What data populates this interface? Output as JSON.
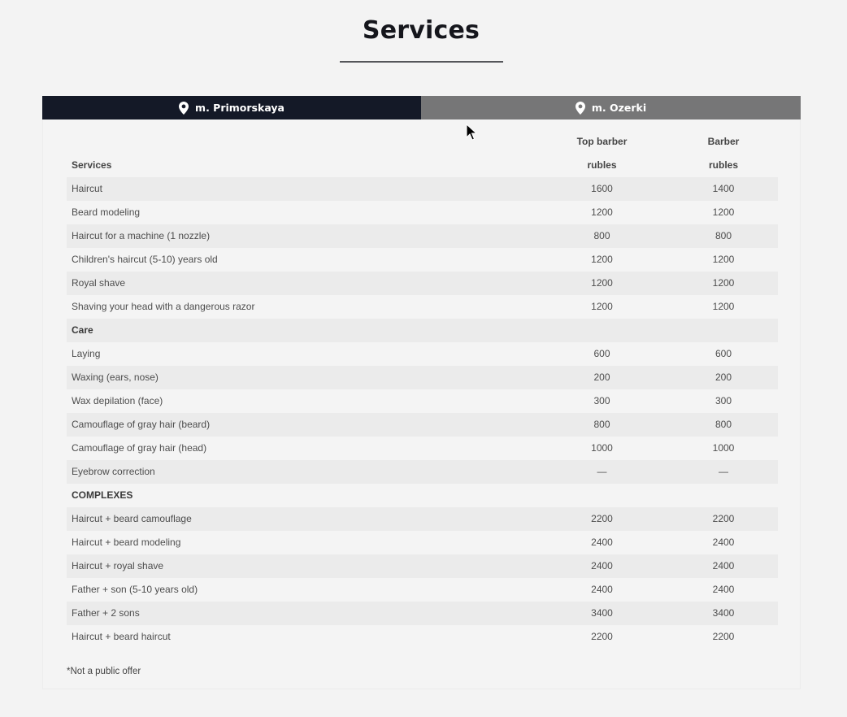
{
  "page_title": "Services",
  "tabs": [
    {
      "label": "m. Primorskaya",
      "active": true,
      "icon": "map-pin-icon"
    },
    {
      "label": "m. Ozerki",
      "active": false,
      "icon": "map-pin-icon"
    }
  ],
  "table": {
    "header_top": [
      "",
      "Top barber",
      "Barber"
    ],
    "header_bottom": [
      "Services",
      "rubles",
      "rubles"
    ],
    "rows": [
      {
        "name": "Haircut",
        "top": "1600",
        "barber": "1400",
        "type": "item"
      },
      {
        "name": "Beard modeling",
        "top": "1200",
        "barber": "1200",
        "type": "item"
      },
      {
        "name": "Haircut for a machine (1 nozzle)",
        "top": "800",
        "barber": "800",
        "type": "item"
      },
      {
        "name": "Children's haircut (5-10) years old",
        "top": "1200",
        "barber": "1200",
        "type": "item"
      },
      {
        "name": "Royal shave",
        "top": "1200",
        "barber": "1200",
        "type": "item"
      },
      {
        "name": "Shaving your head with a dangerous razor",
        "top": "1200",
        "barber": "1200",
        "type": "item"
      },
      {
        "name": "Care",
        "top": "",
        "barber": "",
        "type": "section"
      },
      {
        "name": "Laying",
        "top": "600",
        "barber": "600",
        "type": "item"
      },
      {
        "name": "Waxing (ears, nose)",
        "top": "200",
        "barber": "200",
        "type": "item"
      },
      {
        "name": "Wax depilation (face)",
        "top": "300",
        "barber": "300",
        "type": "item"
      },
      {
        "name": "Camouflage of gray hair (beard)",
        "top": "800",
        "barber": "800",
        "type": "item"
      },
      {
        "name": "Camouflage of gray hair (head)",
        "top": "1000",
        "barber": "1000",
        "type": "item"
      },
      {
        "name": "Eyebrow correction",
        "top": "—",
        "barber": "—",
        "type": "item"
      },
      {
        "name": "COMPLEXES",
        "top": "",
        "barber": "",
        "type": "section"
      },
      {
        "name": "Haircut + beard camouflage",
        "top": "2200",
        "barber": "2200",
        "type": "item"
      },
      {
        "name": "Haircut + beard modeling",
        "top": "2400",
        "barber": "2400",
        "type": "item"
      },
      {
        "name": "Haircut + royal shave",
        "top": "2400",
        "barber": "2400",
        "type": "item"
      },
      {
        "name": "Father + son (5-10 years old)",
        "top": "2400",
        "barber": "2400",
        "type": "item"
      },
      {
        "name": "Father + 2 sons",
        "top": "3400",
        "barber": "3400",
        "type": "item"
      },
      {
        "name": "Haircut + beard haircut",
        "top": "2200",
        "barber": "2200",
        "type": "item"
      }
    ]
  },
  "footnote": "*Not a public offer",
  "colors": {
    "tab_active": "#141927",
    "tab_inactive": "#767677",
    "stripe": "#ebebeb"
  }
}
